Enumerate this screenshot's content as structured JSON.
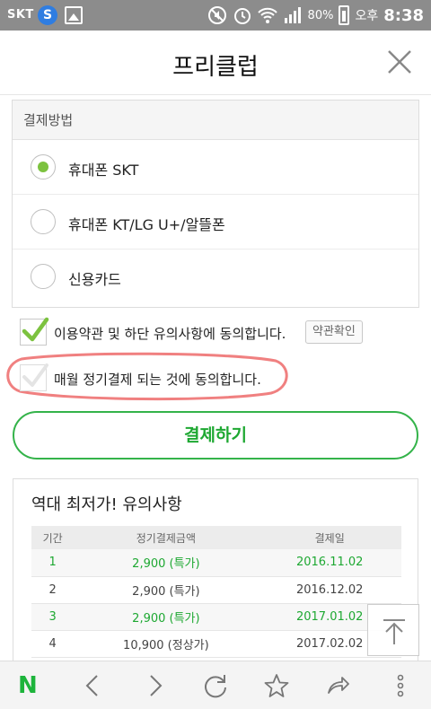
{
  "status_bar": {
    "carrier": "SKT",
    "s_badge": "S",
    "battery_percent": "80%",
    "ampm": "오후",
    "time": "8:38"
  },
  "header": {
    "title": "프리클럽"
  },
  "payment": {
    "section_label": "결제방법",
    "options": [
      {
        "label": "휴대폰 SKT",
        "selected": true
      },
      {
        "label": "휴대폰 KT/LG U+/알뜰폰",
        "selected": false
      },
      {
        "label": "신용카드",
        "selected": false
      }
    ]
  },
  "agreements": {
    "terms_text": "이용약관 및 하단 유의사항에 동의합니다.",
    "terms_checked": true,
    "terms_button": "약관확인",
    "monthly_text": "매월 정기결제 되는 것에 동의합니다.",
    "monthly_checked": false
  },
  "pay_button": "결제하기",
  "notice": {
    "title": "역대 최저가! 유의사항",
    "columns": [
      "기간",
      "정기결제금액",
      "결제일"
    ],
    "rows": [
      {
        "period": "1",
        "amount": "2,900 (특가)",
        "date": "2016.11.02",
        "highlight": true
      },
      {
        "period": "2",
        "amount": "2,900 (특가)",
        "date": "2016.12.02",
        "highlight": false
      },
      {
        "period": "3",
        "amount": "2,900 (특가)",
        "date": "2017.01.02",
        "highlight": true
      },
      {
        "period": "4",
        "amount": "10,900 (정상가)",
        "date": "2017.02.02",
        "highlight": false
      }
    ]
  },
  "bottom_bar": {
    "logo": "N",
    "icons": [
      "back-icon",
      "forward-icon",
      "refresh-icon",
      "star-icon",
      "share-icon",
      "more-icon"
    ]
  },
  "colors": {
    "accent_green": "#1ea832",
    "radio_green": "#7cc23f",
    "status_bar": "#8c8c8c",
    "annotation_pink": "#f08080"
  }
}
